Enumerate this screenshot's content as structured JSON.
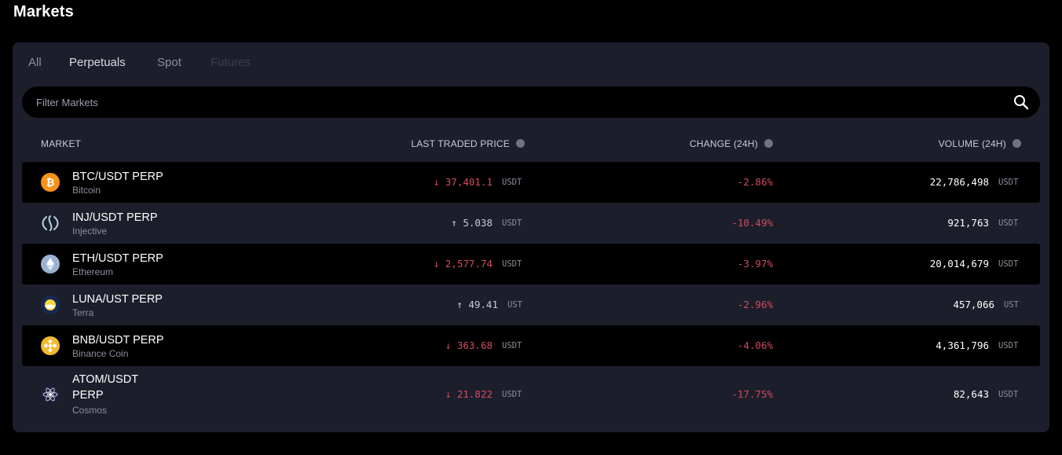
{
  "page_title": "Markets",
  "tabs": [
    {
      "label": "All",
      "state": "inactive"
    },
    {
      "label": "Perpetuals",
      "state": "active"
    },
    {
      "label": "Spot",
      "state": "inactive"
    },
    {
      "label": "Futures",
      "state": "disabled"
    }
  ],
  "search": {
    "placeholder": "Filter Markets",
    "value": "",
    "icon": "search-icon"
  },
  "table": {
    "headers": {
      "market": "MARKET",
      "last_traded_price": "LAST TRADED PRICE",
      "change_24h": "CHANGE (24H)",
      "volume_24h": "VOLUME (24H)"
    },
    "rows": [
      {
        "market": "BTC/USDT PERP",
        "name": "Bitcoin",
        "icon": "bitcoin-icon",
        "price": "37,401.1",
        "direction": "down",
        "arrow": "↓",
        "price_unit": "USDT",
        "change": "-2.86%",
        "volume": "22,786,498",
        "volume_unit": "USDT"
      },
      {
        "market": "INJ/USDT PERP",
        "name": "Injective",
        "icon": "injective-icon",
        "price": "5.038",
        "direction": "up",
        "arrow": "↑",
        "price_unit": "USDT",
        "change": "-10.49%",
        "volume": "921,763",
        "volume_unit": "USDT"
      },
      {
        "market": "ETH/USDT PERP",
        "name": "Ethereum",
        "icon": "ethereum-icon",
        "price": "2,577.74",
        "direction": "down",
        "arrow": "↓",
        "price_unit": "USDT",
        "change": "-3.97%",
        "volume": "20,014,679",
        "volume_unit": "USDT"
      },
      {
        "market": "LUNA/UST PERP",
        "name": "Terra",
        "icon": "terra-icon",
        "price": "49.41",
        "direction": "up",
        "arrow": "↑",
        "price_unit": "UST",
        "change": "-2.96%",
        "volume": "457,066",
        "volume_unit": "UST"
      },
      {
        "market": "BNB/USDT PERP",
        "name": "Binance Coin",
        "icon": "binance-icon",
        "price": "363.68",
        "direction": "down",
        "arrow": "↓",
        "price_unit": "USDT",
        "change": "-4.06%",
        "volume": "4,361,796",
        "volume_unit": "USDT"
      },
      {
        "market": "ATOM/USDT PERP",
        "name": "Cosmos",
        "icon": "cosmos-icon",
        "price": "21.822",
        "direction": "down",
        "arrow": "↓",
        "price_unit": "USDT",
        "change": "-17.75%",
        "volume": "82,643",
        "volume_unit": "USDT"
      }
    ]
  },
  "colors": {
    "background": "#000000",
    "panel": "#1c1f2b",
    "negative": "#d24a5e",
    "muted_text": "#8a8f9e",
    "primary_text": "#ffffff"
  }
}
